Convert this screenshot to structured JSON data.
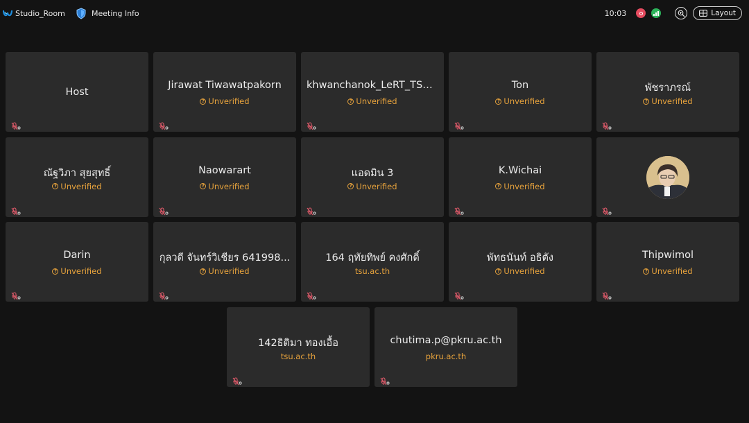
{
  "app": {
    "title": "Studio_Room"
  },
  "header": {
    "meeting_info_label": "Meeting Info",
    "time": "10:03",
    "layout_label": "Layout"
  },
  "colors": {
    "background": "#131313",
    "tile": "#2b2b2b",
    "unverified": "#e6a23c",
    "record": "#e54b5f",
    "network": "#2cb25a",
    "muted_mic": "#e05a6a"
  },
  "participants": [
    {
      "name": "Host",
      "sub": "",
      "unverified": false,
      "avatar": false
    },
    {
      "name": "Jirawat Tiwawatpakorn",
      "sub": "Unverified",
      "unverified": true,
      "avatar": false
    },
    {
      "name": "khwanchanok_LeRT_TSU SK",
      "sub": "Unverified",
      "unverified": true,
      "avatar": false
    },
    {
      "name": "Ton",
      "sub": "Unverified",
      "unverified": true,
      "avatar": false
    },
    {
      "name": "พัชราภรณ์",
      "sub": "Unverified",
      "unverified": true,
      "avatar": false
    },
    {
      "name": "ณัฐวิภา สุยสุทธิ์",
      "sub": "Unverified",
      "unverified": true,
      "avatar": false
    },
    {
      "name": "Naowarart",
      "sub": "Unverified",
      "unverified": true,
      "avatar": false
    },
    {
      "name": "แอดมิน 3",
      "sub": "Unverified",
      "unverified": true,
      "avatar": false
    },
    {
      "name": "K.Wichai",
      "sub": "Unverified",
      "unverified": true,
      "avatar": false
    },
    {
      "name": "",
      "sub": "",
      "unverified": false,
      "avatar": true
    },
    {
      "name": "Darin",
      "sub": "Unverified",
      "unverified": true,
      "avatar": false
    },
    {
      "name": "กุลวดี จันทร์วิเชียร 641998...",
      "sub": "Unverified",
      "unverified": true,
      "avatar": false
    },
    {
      "name": "164 ฤทัยทิพย์ คงศักดิ์",
      "sub": "tsu.ac.th",
      "unverified": false,
      "avatar": false
    },
    {
      "name": "พัทธนันท์  อธิตัง",
      "sub": "Unverified",
      "unverified": true,
      "avatar": false
    },
    {
      "name": "Thipwimol",
      "sub": "Unverified",
      "unverified": true,
      "avatar": false
    },
    {
      "name": "142ธิติมา ทองเอื้อ",
      "sub": "tsu.ac.th",
      "unverified": false,
      "avatar": false
    },
    {
      "name": "chutima.p@pkru.ac.th",
      "sub": "pkru.ac.th",
      "unverified": false,
      "avatar": false
    }
  ]
}
